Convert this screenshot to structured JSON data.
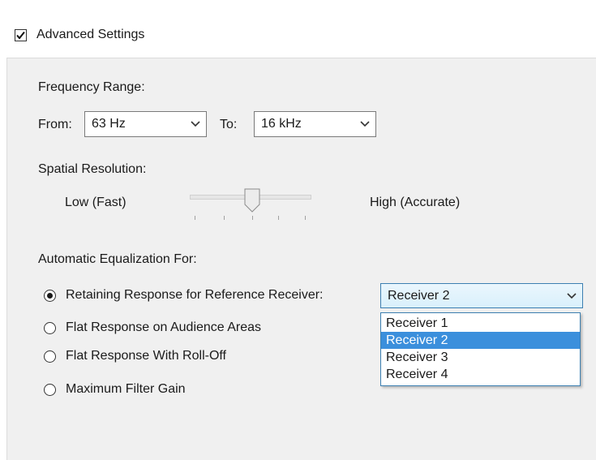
{
  "advanced": {
    "label": "Advanced Settings",
    "checked": true
  },
  "frequency": {
    "heading": "Frequency Range:",
    "from_label": "From:",
    "from_value": "63 Hz",
    "to_label": "To:",
    "to_value": "16 kHz"
  },
  "spatial": {
    "heading": "Spatial Resolution:",
    "low_label": "Low (Fast)",
    "high_label": "High (Accurate)",
    "level_fraction": 0.5
  },
  "equalization": {
    "heading": "Automatic Equalization For:",
    "options": [
      {
        "label": "Retaining Response for Reference Receiver:",
        "selected": true
      },
      {
        "label": "Flat Response on Audience Areas",
        "selected": false
      },
      {
        "label": "Flat Response With Roll-Off",
        "selected": false
      },
      {
        "label": "Maximum Filter Gain",
        "selected": false
      }
    ],
    "receiver_value": "Receiver 2",
    "receiver_options": [
      "Receiver 1",
      "Receiver 2",
      "Receiver 3",
      "Receiver 4"
    ],
    "receiver_highlighted": "Receiver 2"
  },
  "colors": {
    "panel_bg": "#f0f0f0",
    "selection_blue": "#3b8fdc",
    "focus_border": "#3c7fb1"
  }
}
